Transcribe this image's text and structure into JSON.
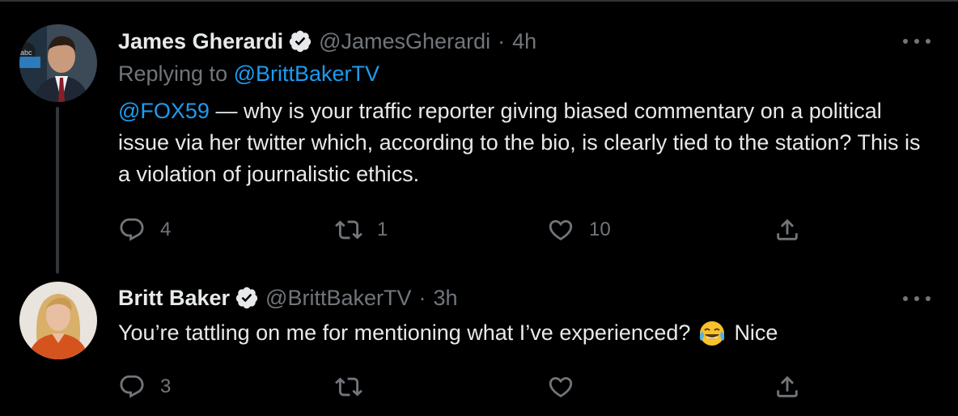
{
  "colors": {
    "background": "#000000",
    "text": "#e7e9ea",
    "muted": "#71767b",
    "accent": "#1d9bf0"
  },
  "tweets": [
    {
      "author_name": "James Gherardi",
      "verified": true,
      "handle": "@JamesGherardi",
      "separator": "·",
      "time": "4h",
      "replying_prefix": "Replying to ",
      "replying_to": "@BrittBakerTV",
      "mention": "@FOX59",
      "text": " — why is your traffic reporter giving biased commentary on a political issue via her twitter which, according to the bio, is clearly tied to the station? This is a violation of journalistic ethics.",
      "actions": {
        "reply_count": "4",
        "retweet_count": "1",
        "like_count": "10"
      }
    },
    {
      "author_name": "Britt Baker",
      "verified": true,
      "handle": "@BrittBakerTV",
      "separator": "·",
      "time": "3h",
      "text_before_emoji": "You’re tattling on me for mentioning what I’ve experienced?",
      "emoji": "face-with-tears-of-joy",
      "text_after_emoji": "Nice",
      "actions": {
        "reply_count": "3",
        "retweet_count": "",
        "like_count": ""
      }
    }
  ]
}
